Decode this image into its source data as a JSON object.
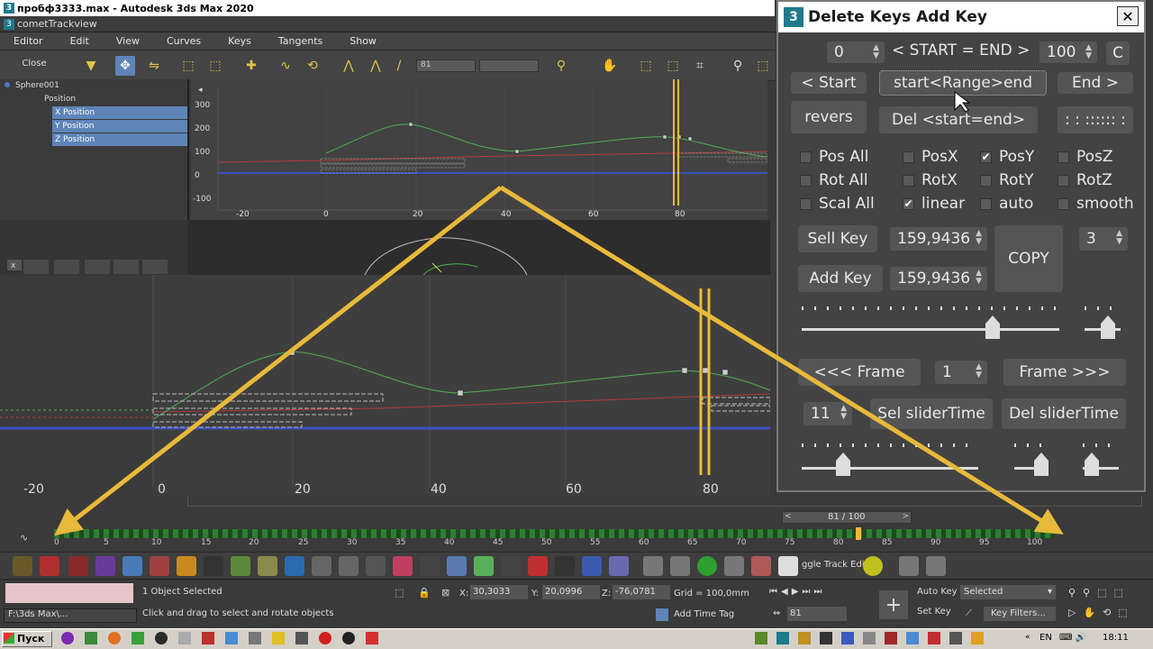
{
  "window": {
    "app_title": "пробф3333.max - Autodesk 3ds Max 2020",
    "trackview_title": "cometTrackview"
  },
  "menu": [
    "Editor",
    "Edit",
    "View",
    "Curves",
    "Keys",
    "Tangents",
    "Show"
  ],
  "toolbar": {
    "close_label": "Close",
    "frame_field": "81"
  },
  "tree": {
    "items": [
      {
        "label": "Sphere001",
        "selected": false
      },
      {
        "label": "Position",
        "selected": false
      },
      {
        "label": "X Position",
        "selected": true
      },
      {
        "label": "Y Position",
        "selected": true
      },
      {
        "label": "Z Position",
        "selected": true
      }
    ]
  },
  "curve_top": {
    "y_ticks": [
      "300",
      "200",
      "100",
      "0",
      "-100"
    ],
    "x_ticks": [
      "-20",
      "0",
      "20",
      "40",
      "60",
      "80"
    ]
  },
  "curve_bottom": {
    "x_ticks": [
      "-20",
      "0",
      "20",
      "40",
      "60",
      "80"
    ]
  },
  "mid_view": {
    "close_x": "x"
  },
  "timeline": {
    "slider_label": "81 / 100",
    "ticks": [
      "0",
      "5",
      "10",
      "15",
      "20",
      "25",
      "30",
      "35",
      "40",
      "45",
      "50",
      "55",
      "60",
      "65",
      "70",
      "75",
      "80",
      "85",
      "90",
      "95",
      "100"
    ]
  },
  "status": {
    "selection": "1 Object Selected",
    "prompt": "Click and drag to select and rotate objects",
    "x_label": "X:",
    "x_value": "30,3033",
    "y_label": "Y:",
    "y_value": "20,0996",
    "z_label": "Z:",
    "z_value": "-76,0781",
    "grid": "Grid = 100,0mm",
    "add_time_tag": "Add Time Tag",
    "auto_key": "Auto Key",
    "set_key": "Set Key",
    "selected_dropdown": "Selected",
    "key_filters": "Key Filters...",
    "current_frame": "81",
    "path_field": "F:\\3ds Max\\...",
    "toggle_track": "ggle Track Edi"
  },
  "taskbar": {
    "start": "Пуск",
    "lang": "EN",
    "clock": "18:11"
  },
  "dialog": {
    "title": "Delete Keys Add Key",
    "close": "✕",
    "start_value": "0",
    "start_end_label": "< START = END >",
    "end_value": "100",
    "c_button": "C",
    "btn_start": "< Start",
    "btn_range": "start<Range>end",
    "btn_end": "End >",
    "btn_revers": "revers",
    "btn_del_start_end": "Del <start=end>",
    "btn_dots": ": : :::::: :",
    "checks": [
      {
        "label": "Pos All",
        "checked": false
      },
      {
        "label": "PosX",
        "checked": false
      },
      {
        "label": "PosY",
        "checked": true
      },
      {
        "label": "PosZ",
        "checked": false
      },
      {
        "label": "Rot All",
        "checked": false
      },
      {
        "label": "RotX",
        "checked": false
      },
      {
        "label": "RotY",
        "checked": false
      },
      {
        "label": "RotZ",
        "checked": false
      },
      {
        "label": "Scal All",
        "checked": false
      },
      {
        "label": "linear",
        "checked": true
      },
      {
        "label": "auto",
        "checked": false
      },
      {
        "label": "smooth",
        "checked": false
      }
    ],
    "btn_sel_key": "Sell Key",
    "sel_key_value": "159,9436",
    "btn_add_key": "Add Key",
    "add_key_value": "159,9436",
    "btn_copy": "COPY",
    "copy_count": "3",
    "btn_prev_frame": "<<< Frame",
    "frame_step": "1",
    "btn_next_frame": "Frame >>>",
    "slider_time_value": "11",
    "btn_sel_slider_time": "Sel sliderTime",
    "btn_del_slider_time": "Del sliderTime"
  },
  "colors": {
    "accent_yellow": "#e8b93a",
    "curve_green": "#4caf50",
    "curve_red": "#b33a3a",
    "curve_blue": "#3a4fc0",
    "selection_blue": "#5e84b8"
  }
}
